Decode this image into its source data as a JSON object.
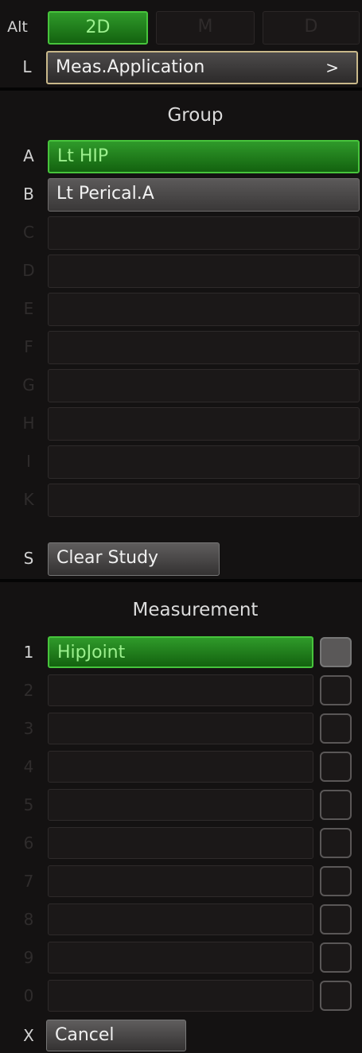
{
  "top": {
    "alt_key": "Alt",
    "modes": [
      {
        "label": "2D",
        "active": true
      },
      {
        "label": "M",
        "active": false
      },
      {
        "label": "D",
        "active": false
      }
    ],
    "l_key": "L",
    "meas_app_label": "Meas.Application",
    "meas_app_arrow": ">"
  },
  "group": {
    "header": "Group",
    "items": [
      {
        "key": "A",
        "label": "Lt  HIP",
        "state": "selected"
      },
      {
        "key": "B",
        "label": "Lt  Perical.A",
        "state": "normal"
      },
      {
        "key": "C",
        "label": "",
        "state": "empty"
      },
      {
        "key": "D",
        "label": "",
        "state": "empty"
      },
      {
        "key": "E",
        "label": "",
        "state": "empty"
      },
      {
        "key": "F",
        "label": "",
        "state": "empty"
      },
      {
        "key": "G",
        "label": "",
        "state": "empty"
      },
      {
        "key": "H",
        "label": "",
        "state": "empty"
      },
      {
        "key": "I",
        "label": "",
        "state": "empty"
      },
      {
        "key": "K",
        "label": "",
        "state": "empty"
      }
    ],
    "clear_key": "S",
    "clear_label": "Clear  Study"
  },
  "measurement": {
    "header": "Measurement",
    "items": [
      {
        "key": "1",
        "label": "HipJoint",
        "state": "selected",
        "checked": true
      },
      {
        "key": "2",
        "label": "",
        "state": "empty",
        "checked": false
      },
      {
        "key": "3",
        "label": "",
        "state": "empty",
        "checked": false
      },
      {
        "key": "4",
        "label": "",
        "state": "empty",
        "checked": false
      },
      {
        "key": "5",
        "label": "",
        "state": "empty",
        "checked": false
      },
      {
        "key": "6",
        "label": "",
        "state": "empty",
        "checked": false
      },
      {
        "key": "7",
        "label": "",
        "state": "empty",
        "checked": false
      },
      {
        "key": "8",
        "label": "",
        "state": "empty",
        "checked": false
      },
      {
        "key": "9",
        "label": "",
        "state": "empty",
        "checked": false
      },
      {
        "key": "0",
        "label": "",
        "state": "empty",
        "checked": false
      }
    ],
    "cancel_key": "X",
    "cancel_label": "Cancel"
  }
}
